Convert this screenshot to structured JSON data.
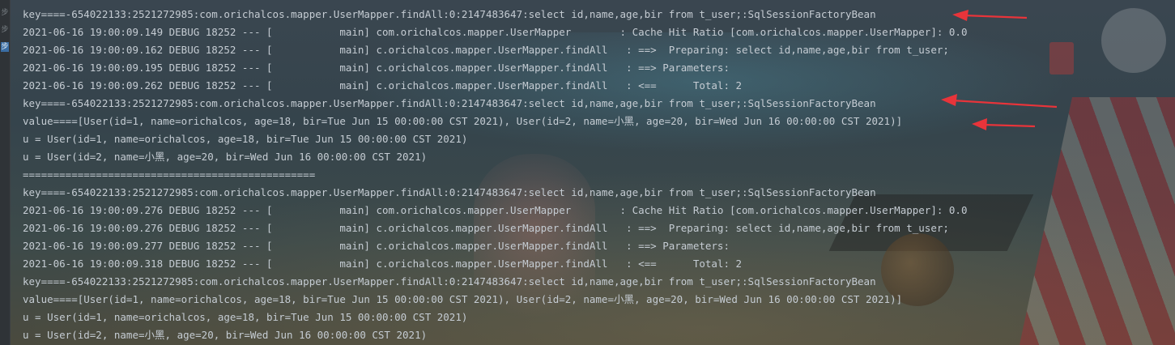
{
  "console": {
    "lines": [
      "key====-654022133:2521272985:com.orichalcos.mapper.UserMapper.findAll:0:2147483647:select id,name,age,bir from t_user;:SqlSessionFactoryBean",
      "2021-06-16 19:00:09.149 DEBUG 18252 --- [           main] com.orichalcos.mapper.UserMapper        : Cache Hit Ratio [com.orichalcos.mapper.UserMapper]: 0.0",
      "2021-06-16 19:00:09.162 DEBUG 18252 --- [           main] c.orichalcos.mapper.UserMapper.findAll   : ==>  Preparing: select id,name,age,bir from t_user;",
      "2021-06-16 19:00:09.195 DEBUG 18252 --- [           main] c.orichalcos.mapper.UserMapper.findAll   : ==> Parameters: ",
      "2021-06-16 19:00:09.262 DEBUG 18252 --- [           main] c.orichalcos.mapper.UserMapper.findAll   : <==      Total: 2",
      "key====-654022133:2521272985:com.orichalcos.mapper.UserMapper.findAll:0:2147483647:select id,name,age,bir from t_user;:SqlSessionFactoryBean",
      "value====[User(id=1, name=orichalcos, age=18, bir=Tue Jun 15 00:00:00 CST 2021), User(id=2, name=小黑, age=20, bir=Wed Jun 16 00:00:00 CST 2021)]",
      "u = User(id=1, name=orichalcos, age=18, bir=Tue Jun 15 00:00:00 CST 2021)",
      "u = User(id=2, name=小黑, age=20, bir=Wed Jun 16 00:00:00 CST 2021)",
      "================================================",
      "key====-654022133:2521272985:com.orichalcos.mapper.UserMapper.findAll:0:2147483647:select id,name,age,bir from t_user;:SqlSessionFactoryBean",
      "2021-06-16 19:00:09.276 DEBUG 18252 --- [           main] com.orichalcos.mapper.UserMapper        : Cache Hit Ratio [com.orichalcos.mapper.UserMapper]: 0.0",
      "2021-06-16 19:00:09.276 DEBUG 18252 --- [           main] c.orichalcos.mapper.UserMapper.findAll   : ==>  Preparing: select id,name,age,bir from t_user;",
      "2021-06-16 19:00:09.277 DEBUG 18252 --- [           main] c.orichalcos.mapper.UserMapper.findAll   : ==> Parameters: ",
      "2021-06-16 19:00:09.318 DEBUG 18252 --- [           main] c.orichalcos.mapper.UserMapper.findAll   : <==      Total: 2",
      "key====-654022133:2521272985:com.orichalcos.mapper.UserMapper.findAll:0:2147483647:select id,name,age,bir from t_user;:SqlSessionFactoryBean",
      "value====[User(id=1, name=orichalcos, age=18, bir=Tue Jun 15 00:00:00 CST 2021), User(id=2, name=小黑, age=20, bir=Wed Jun 16 00:00:00 CST 2021)]",
      "u = User(id=1, name=orichalcos, age=18, bir=Tue Jun 15 00:00:00 CST 2021)",
      "u = User(id=2, name=小黑, age=20, bir=Wed Jun 16 00:00:00 CST 2021)"
    ]
  },
  "gutter": {
    "icons": [
      "step-icon",
      "step-icon",
      "step-active-icon"
    ],
    "glyphs": [
      "步",
      "步",
      "步"
    ]
  },
  "colors": {
    "text": "#c5ccd3",
    "annotation_arrow": "#e8343a",
    "gutter_active": "#3b6ea5"
  }
}
